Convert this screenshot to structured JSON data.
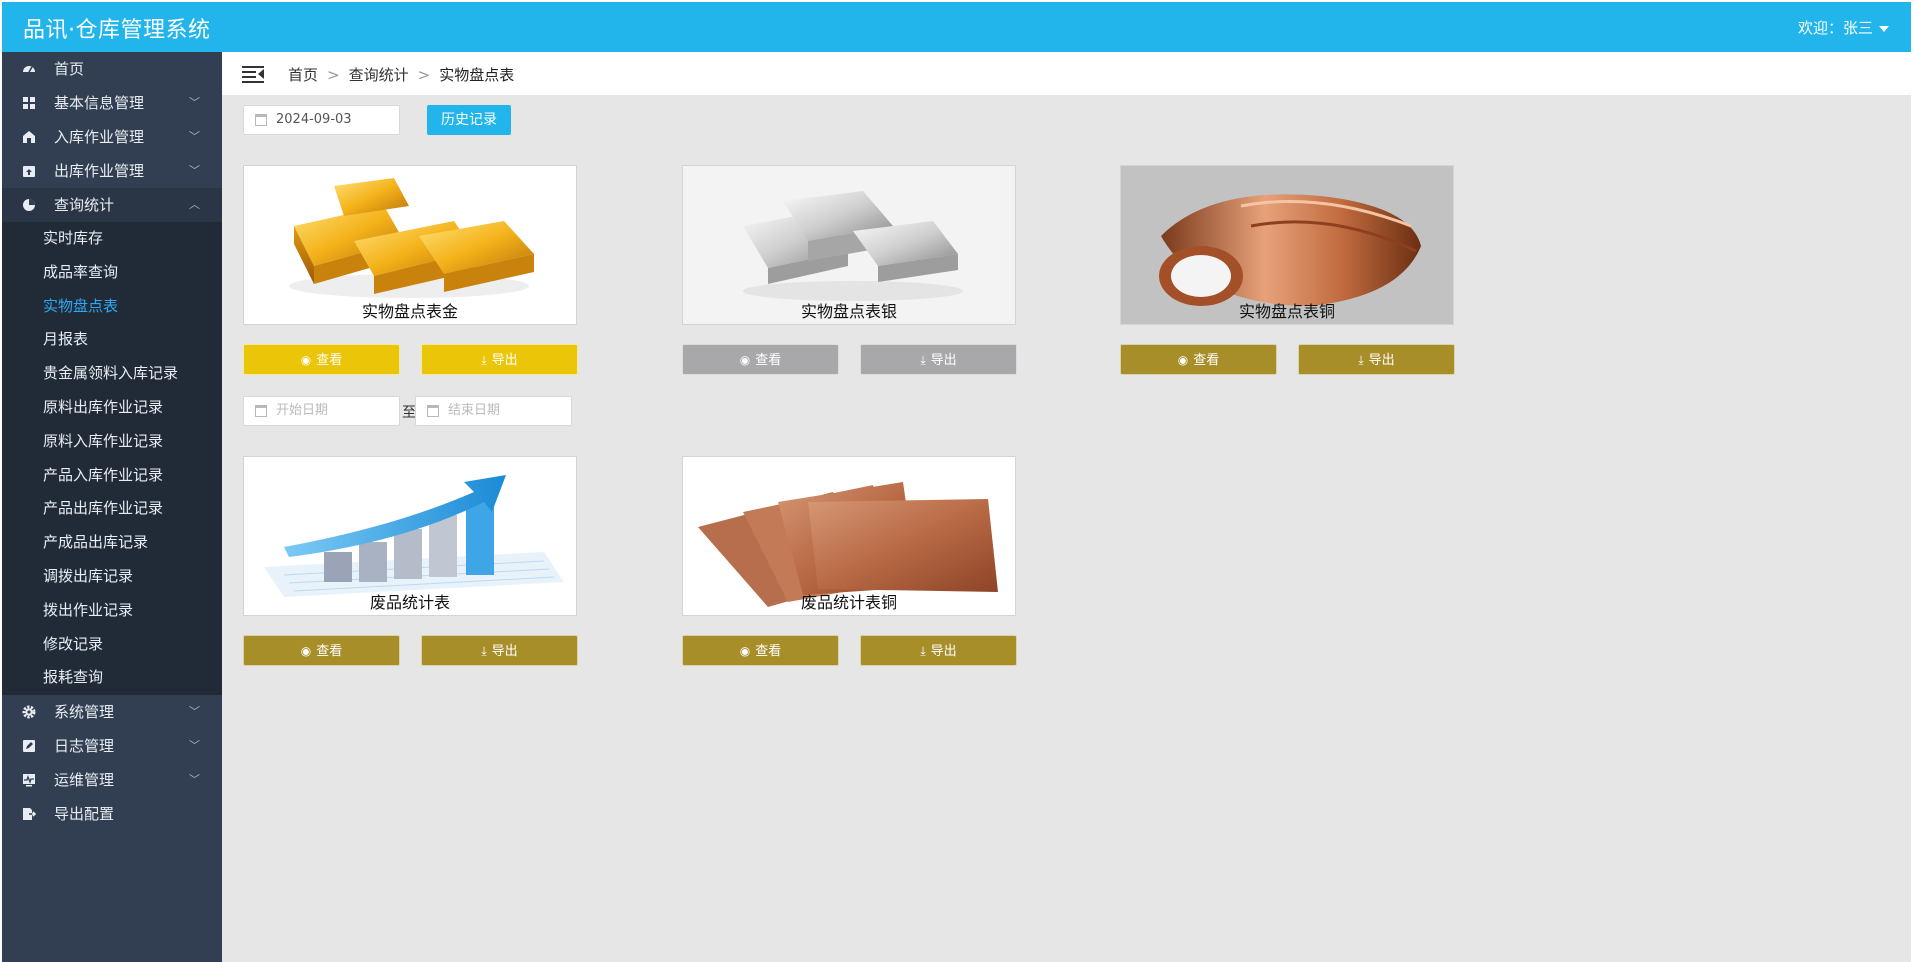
{
  "app": {
    "title": "品讯·仓库管理系统"
  },
  "user": {
    "greeting": "欢迎：张三"
  },
  "sidebar": {
    "items": [
      {
        "label": "首页",
        "icon": "dashboard-icon"
      },
      {
        "label": "基本信息管理",
        "icon": "grid-icon"
      },
      {
        "label": "入库作业管理",
        "icon": "warehouse-in-icon"
      },
      {
        "label": "出库作业管理",
        "icon": "warehouse-out-icon"
      },
      {
        "label": "查询统计",
        "icon": "pie-chart-icon"
      },
      {
        "label": "系统管理",
        "icon": "gear-icon"
      },
      {
        "label": "日志管理",
        "icon": "edit-icon"
      },
      {
        "label": "运维管理",
        "icon": "monitor-icon"
      },
      {
        "label": "导出配置",
        "icon": "export-icon"
      }
    ],
    "sub_items": [
      {
        "label": "实时库存"
      },
      {
        "label": "成品率查询"
      },
      {
        "label": "实物盘点表"
      },
      {
        "label": "月报表"
      },
      {
        "label": "贵金属领料入库记录"
      },
      {
        "label": "原料出库作业记录"
      },
      {
        "label": "原料入库作业记录"
      },
      {
        "label": "产品入库作业记录"
      },
      {
        "label": "产品出库作业记录"
      },
      {
        "label": "产成品出库记录"
      },
      {
        "label": "调拨出库记录"
      },
      {
        "label": "拨出作业记录"
      },
      {
        "label": "修改记录"
      },
      {
        "label": "报耗查询"
      }
    ],
    "active_sub": "实物盘点表"
  },
  "breadcrumb": {
    "home": "首页",
    "section": "查询统计",
    "current": "实物盘点表",
    "separator": ">"
  },
  "filters": {
    "date_value": "2024-09-03",
    "history_button": "历史记录",
    "start_placeholder": "开始日期",
    "end_placeholder": "结束日期",
    "range_separator": "至"
  },
  "cards": [
    {
      "label": "实物盘点表金",
      "image": "gold-bars",
      "view": "查看",
      "export": "导出",
      "color": "#eac508"
    },
    {
      "label": "实物盘点表银",
      "image": "silver-bars",
      "view": "查看",
      "export": "导出",
      "color": "#a8a8aa"
    },
    {
      "label": "实物盘点表铜",
      "image": "copper-roll",
      "view": "查看",
      "export": "导出",
      "color": "#a88e29"
    },
    {
      "label": "废品统计表",
      "image": "growth-chart",
      "view": "查看",
      "export": "导出",
      "color": "#a88e29"
    },
    {
      "label": "废品统计表铜",
      "image": "copper-sheets",
      "view": "查看",
      "export": "导出",
      "color": "#a88e29"
    }
  ],
  "colors": {
    "topbar": "#21b5eb",
    "sidebar": "#323f52",
    "submenu": "#212b38",
    "active": "#2ea8f0"
  }
}
